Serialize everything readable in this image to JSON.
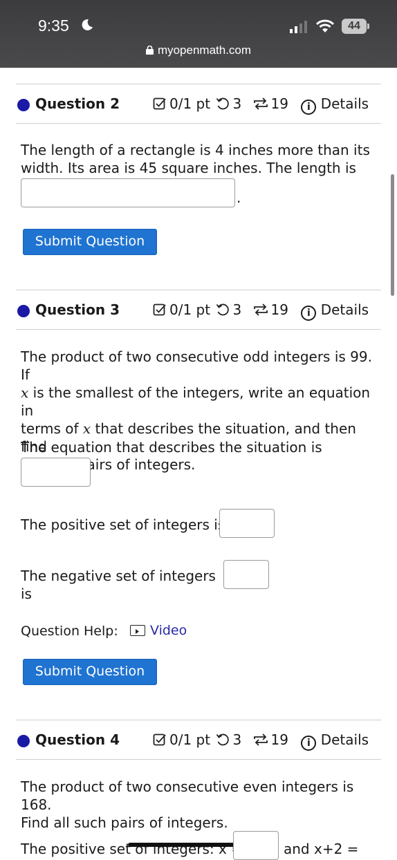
{
  "status_bar": {
    "time": "9:35",
    "battery": "44",
    "url": "myopenmath.com"
  },
  "questions": [
    {
      "title": "Question 2",
      "score": "0/1 pt",
      "retries": "3",
      "attempts": "19",
      "details": "Details",
      "text_lines": [
        "The length of a rectangle is 4 inches more than its",
        "width. Its area is 45 square inches. The length is"
      ],
      "period": ".",
      "submit": "Submit Question"
    },
    {
      "title": "Question 3",
      "score": "0/1 pt",
      "retries": "3",
      "attempts": "19",
      "details": "Details",
      "line1": "The product of two consecutive odd integers is 99. If",
      "line2_var": "x",
      "line2_rest": " is the smallest of the integers, write an equation in",
      "line3_a": "terms of ",
      "line3_var": "x",
      "line3_b": " that describes the situation, and then find",
      "line4": "all such pairs of integers.",
      "equation_prompt": "The equation that describes the situation is",
      "positive_prompt": "The positive set of integers is",
      "negative_prompt": "The negative set of integers is",
      "help_label": "Question Help:",
      "video_label": "Video",
      "submit": "Submit Question"
    },
    {
      "title": "Question 4",
      "score": "0/1 pt",
      "retries": "3",
      "attempts": "19",
      "details": "Details",
      "text_lines": [
        "The product of two consecutive even integers is 168.",
        "Find all such pairs of integers."
      ],
      "positive_prompt": "The positive set of integers: x =",
      "and_label": "and x+2 ="
    }
  ]
}
